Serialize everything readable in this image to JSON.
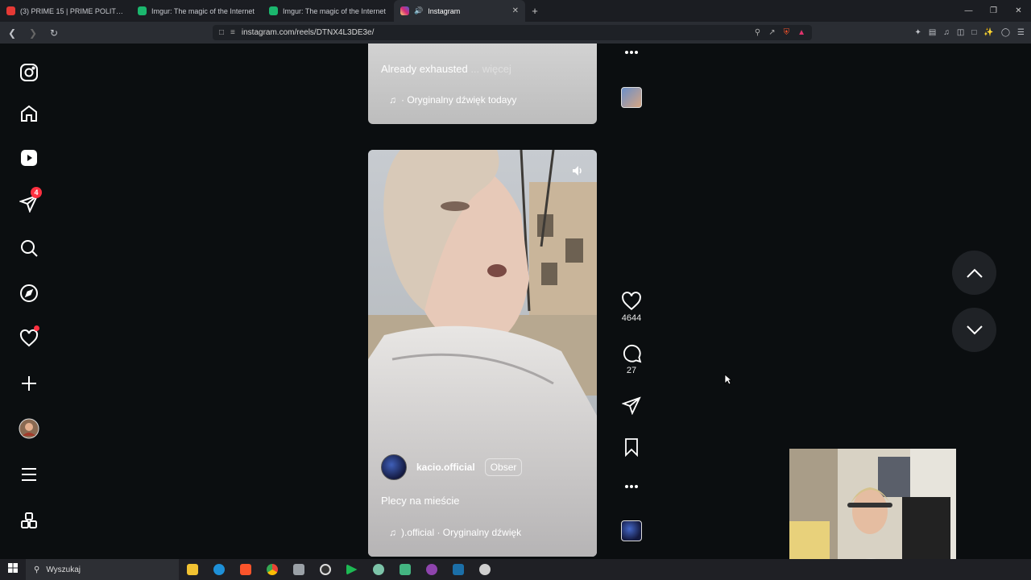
{
  "browser": {
    "tabs": [
      {
        "title": "(3) PRIME 15 | PRIME POLITYK SH",
        "color": "#e53935",
        "active": false
      },
      {
        "title": "Imgur: The magic of the Internet",
        "color": "#1bb76e",
        "active": false
      },
      {
        "title": "Imgur: The magic of the Internet",
        "color": "#1bb76e",
        "active": false
      },
      {
        "title": "Instagram",
        "color": "#d62976",
        "active": true
      }
    ],
    "new_tab": "+",
    "url": "instagram.com/reels/DTNX4L3DE3e/"
  },
  "sidenav": {
    "items": [
      {
        "name": "instagram-logo-icon"
      },
      {
        "name": "home-icon"
      },
      {
        "name": "reels-icon"
      },
      {
        "name": "messages-icon",
        "badge": "4"
      },
      {
        "name": "search-icon"
      },
      {
        "name": "explore-icon"
      },
      {
        "name": "notifications-icon"
      },
      {
        "name": "create-icon"
      },
      {
        "name": "profile-icon"
      },
      {
        "name": "more-menu-icon"
      },
      {
        "name": "apps-icon"
      }
    ]
  },
  "reel_top": {
    "caption": "Already exhausted",
    "more": "... więcej",
    "audio": "· Oryginalny dźwięk  todayy"
  },
  "reel_main": {
    "username": "kacio.official",
    "follow": "Obser",
    "caption": "Plecy na mieście",
    "audio": ").official · Oryginalny dźwięk"
  },
  "actions": {
    "likes": "4644",
    "comments": "27"
  },
  "taskbar": {
    "search_placeholder": "Wyszukaj"
  },
  "colors": {
    "accent_red": "#ff3040",
    "page_bg": "#0b0e10"
  }
}
